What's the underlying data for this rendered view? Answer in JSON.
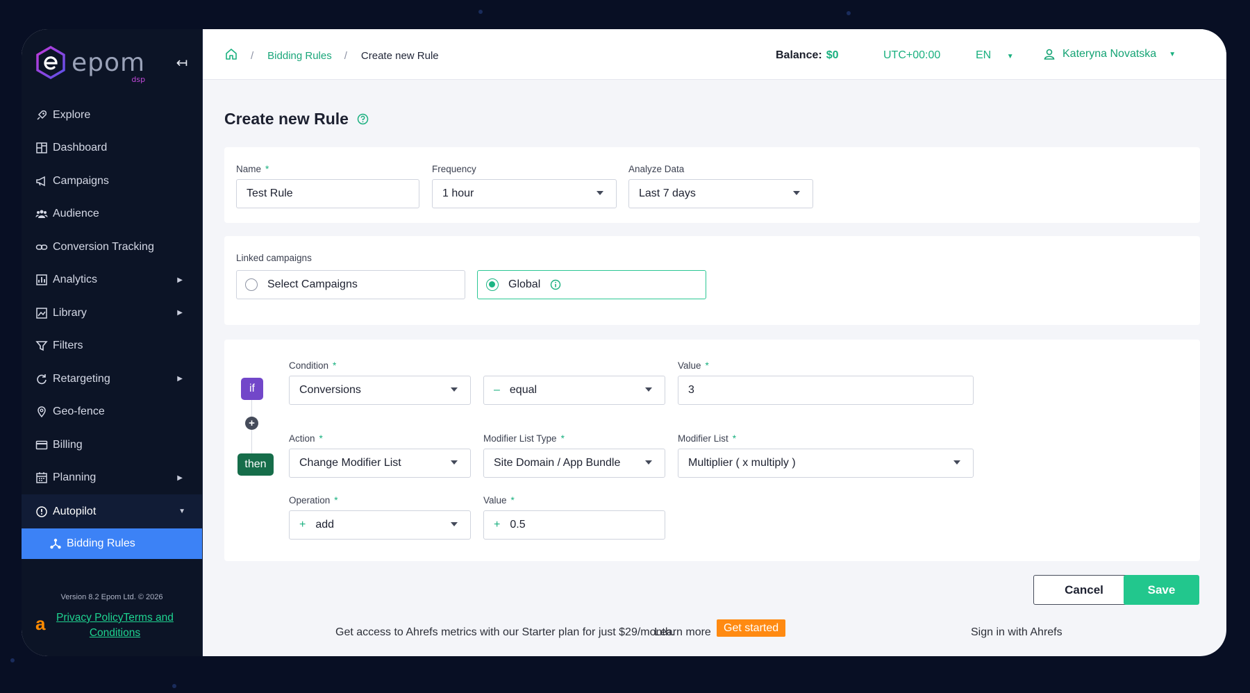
{
  "sidebar": {
    "logo_text": "epom",
    "logo_sub": "dsp",
    "items": [
      {
        "label": "Explore"
      },
      {
        "label": "Dashboard"
      },
      {
        "label": "Campaigns"
      },
      {
        "label": "Audience"
      },
      {
        "label": "Conversion Tracking"
      },
      {
        "label": "Analytics"
      },
      {
        "label": "Library"
      },
      {
        "label": "Filters"
      },
      {
        "label": "Retargeting"
      },
      {
        "label": "Geo-fence"
      },
      {
        "label": "Billing"
      },
      {
        "label": "Planning"
      },
      {
        "label": "Autopilot"
      },
      {
        "label": "Bidding Rules"
      }
    ],
    "version": "Version 8.2 Epom Ltd. © 2026",
    "privacy_link": "Privacy PolicyTerms and Conditions",
    "ahrefs_logo": "a"
  },
  "header": {
    "breadcrumb_link": "Bidding Rules",
    "breadcrumb_current": "Create new Rule",
    "breadcrumb_sep": "/",
    "balance_label": "Balance:",
    "balance_value": "$0",
    "timezone": "UTC+00:00",
    "language": "EN",
    "user_name": "Kateryna Novatska"
  },
  "page": {
    "title": "Create new Rule"
  },
  "form": {
    "name_label": "Name",
    "name_value": "Test Rule",
    "frequency_label": "Frequency",
    "frequency_value": "1 hour",
    "analyze_label": "Analyze Data",
    "analyze_value": "Last 7 days",
    "linked_label": "Linked campaigns",
    "option_select": "Select Campaigns",
    "option_global": "Global",
    "if_tag": "if",
    "then_tag": "then",
    "condition_label": "Condition",
    "condition_value": "Conversions",
    "operator_prefix": "–",
    "operator_value": "equal",
    "value_label": "Value",
    "value_value": "3",
    "action_label": "Action",
    "action_value": "Change Modifier List",
    "modifier_type_label": "Modifier List Type",
    "modifier_type_value": "Site Domain / App Bundle",
    "modifier_list_label": "Modifier List",
    "modifier_list_value": "Multiplier ( x multiply )",
    "operation_label": "Operation",
    "operation_prefix": "+",
    "operation_value": "add",
    "value2_label": "Value",
    "value2_prefix": "+",
    "value2_value": "0.5",
    "required_mark": "*",
    "add_condition": "+"
  },
  "actions": {
    "cancel": "Cancel",
    "save": "Save"
  },
  "promo": {
    "text": "Get access to Ahrefs metrics with our Starter plan for just $29/month.",
    "learn_more": "Learn more",
    "get_started": "Get started",
    "sign_in": "Sign in with Ahrefs"
  },
  "colors": {
    "accent_green": "#1ab07f",
    "active_blue": "#3c82f6",
    "if_purple": "#7247c9",
    "then_green": "#166d4a",
    "sidebar_bg": "#0c1426"
  }
}
